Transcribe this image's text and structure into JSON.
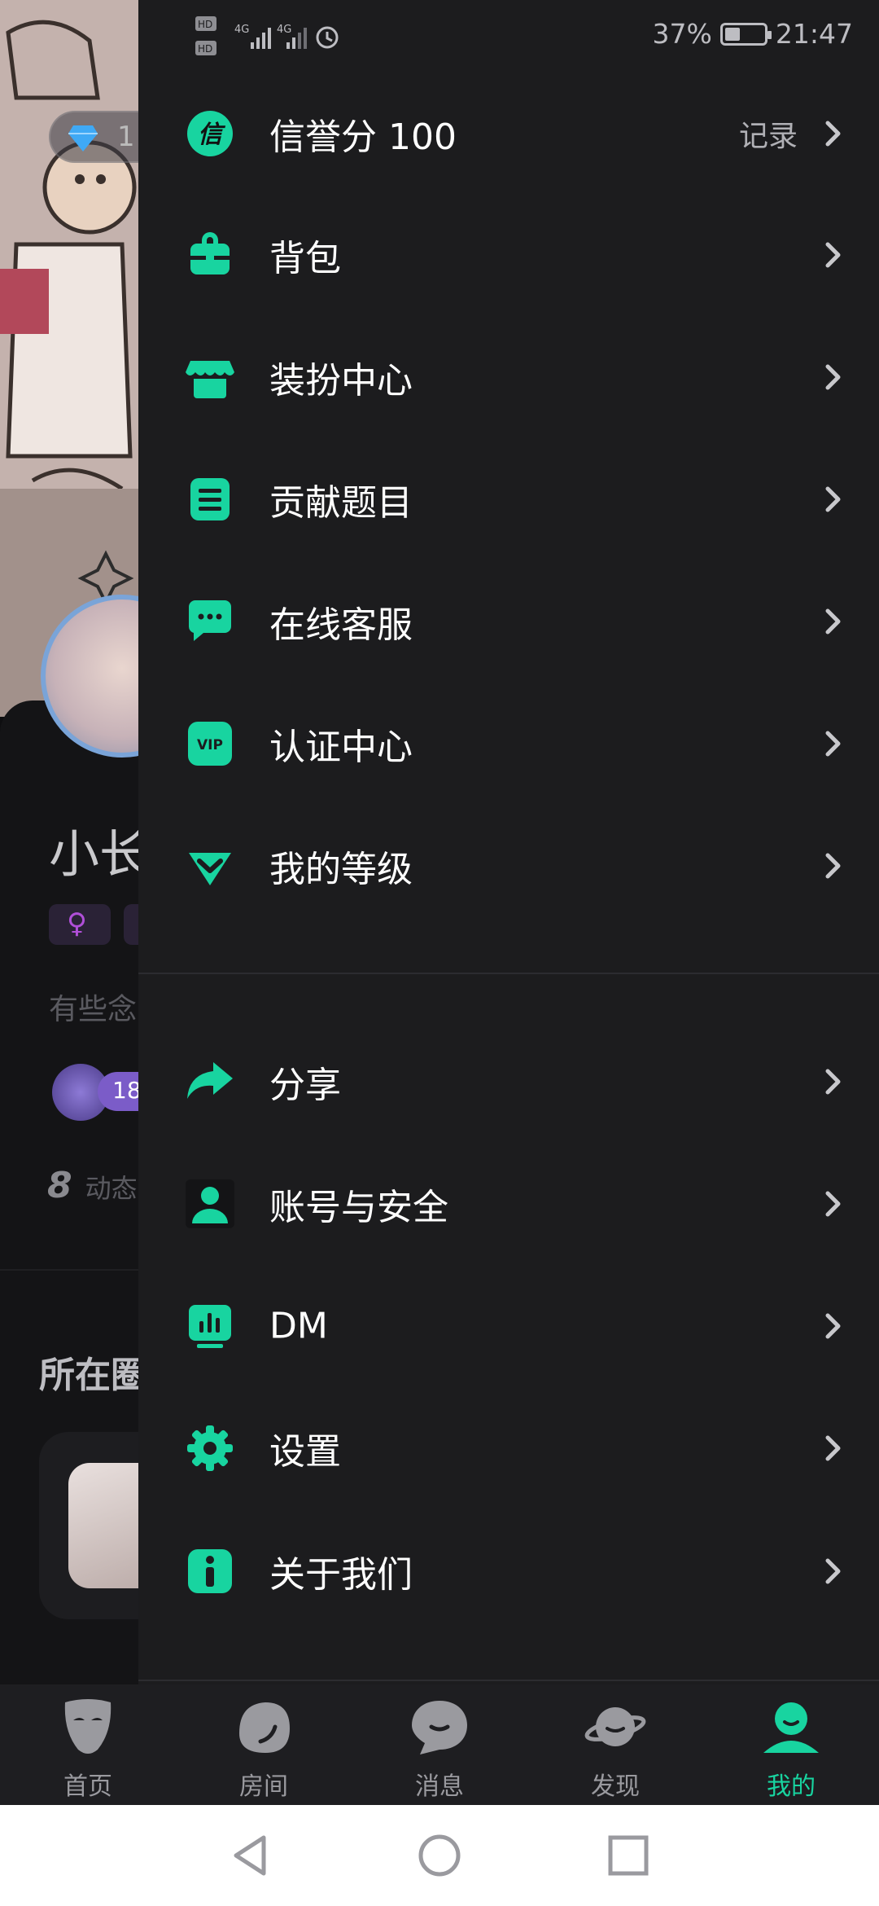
{
  "status_bar": {
    "battery": "37%",
    "time": "21:47",
    "network_icons": [
      "hd-1-icon",
      "hd-2-icon",
      "signal-4g-icon",
      "signal-4g-icon",
      "alarm-icon"
    ]
  },
  "background_profile": {
    "diamond_count": "1",
    "name_partial": "小长",
    "signature_partial": "有些念",
    "level_badge_partial": "18",
    "posts_count": "8",
    "posts_label": "动态",
    "section_title_partial": "所在圈"
  },
  "drawer": {
    "credit": {
      "label": "信誉分 100",
      "action": "记录",
      "icon": "credit-icon"
    },
    "items_top": [
      {
        "label": "背包",
        "icon": "backpack-icon"
      },
      {
        "label": "装扮中心",
        "icon": "store-icon"
      },
      {
        "label": "贡献题目",
        "icon": "document-icon"
      },
      {
        "label": "在线客服",
        "icon": "chat-icon"
      },
      {
        "label": "认证中心",
        "icon": "vip-icon"
      },
      {
        "label": "我的等级",
        "icon": "diamond-icon"
      }
    ],
    "items_bottom": [
      {
        "label": "分享",
        "icon": "share-icon"
      },
      {
        "label": "账号与安全",
        "icon": "user-icon"
      },
      {
        "label": "DM",
        "icon": "chart-icon"
      },
      {
        "label": "设置",
        "icon": "gear-icon"
      },
      {
        "label": "关于我们",
        "icon": "info-icon"
      }
    ]
  },
  "bottom_nav": {
    "items": [
      {
        "label": "首页",
        "icon": "mask-icon"
      },
      {
        "label": "房间",
        "icon": "room-icon"
      },
      {
        "label": "消息",
        "icon": "message-icon"
      },
      {
        "label": "发现",
        "icon": "planet-icon"
      },
      {
        "label": "我的",
        "icon": "profile-icon",
        "active": true
      }
    ]
  },
  "colors": {
    "accent": "#18d4a0",
    "drawer_bg": "#1c1c1e",
    "nav_bg": "#1e1e21",
    "text_primary": "#ffffff",
    "text_secondary": "#b0b0b5"
  }
}
